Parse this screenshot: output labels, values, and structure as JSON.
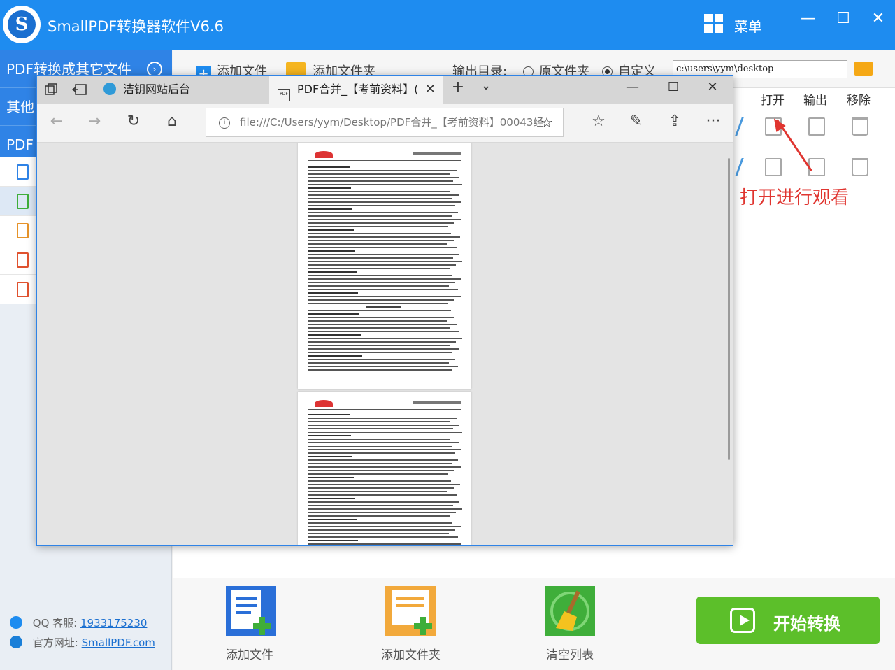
{
  "app": {
    "logo_letter": "S",
    "title": "SmallPDF转换器软件V6.6",
    "menu_label": "菜单",
    "win_min": "—",
    "win_max": "☐",
    "win_close": "✕"
  },
  "sidebar": {
    "nav1": "PDF转换成其它文件",
    "nav2": "其他",
    "nav3": "PDF",
    "arrow": "›",
    "qq_label": "QQ 客服:",
    "qq_value": "1933175230",
    "site_label": "官方网址:",
    "site_value": "SmallPDF.com"
  },
  "toolbar": {
    "add_file": "添加文件",
    "add_folder": "添加文件夹",
    "output_label": "输出目录:",
    "opt_original": "原文件夹",
    "opt_custom": "自定义",
    "output_path": "c:\\users\\yym\\desktop",
    "plus": "+"
  },
  "list": {
    "col_open": "打开",
    "col_output": "输出",
    "col_remove": "移除",
    "annotation": "打开进行观看"
  },
  "bottom": {
    "add_file": "添加文件",
    "add_folder": "添加文件夹",
    "clear_list": "清空列表",
    "start": "开始转换"
  },
  "browser": {
    "tab1": "洁钥网站后台",
    "tab2": "PDF合并_【考前资料】(",
    "tab_close": "✕",
    "new_tab": "+",
    "tab_menu": "⌄",
    "address": "file:///C:/Users/yym/Desktop/PDF合并_【考前资料】00043经",
    "back": "←",
    "forward": "→",
    "refresh": "↻",
    "home": "⌂",
    "star": "☆",
    "favorites": "☆",
    "pen": "✎",
    "share": "⇪",
    "more": "···",
    "min": "—",
    "max": "☐",
    "close": "✕",
    "info": "i"
  },
  "colors": {
    "brand_blue": "#1e8cf0",
    "start_green": "#5cbf2a",
    "annotation_red": "#e03530"
  }
}
